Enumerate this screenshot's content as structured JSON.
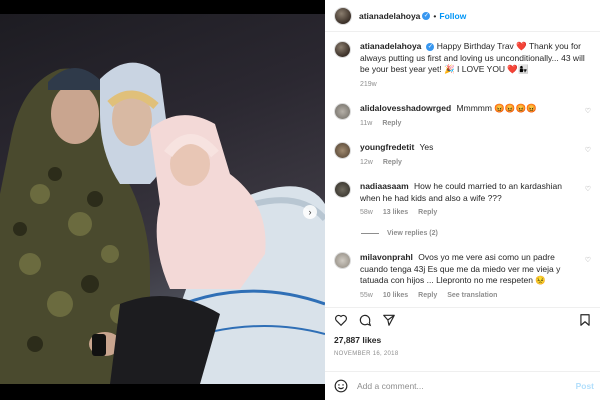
{
  "post": {
    "author": "atianadelahoya",
    "follow_label": "Follow",
    "separator": "•",
    "carousel_total": 3,
    "carousel_index": 1
  },
  "caption": {
    "username": "atianadelahoya",
    "text": "Happy Birthday Trav ❤️ Thank you for always putting us first and loving us unconditionally... 43 will be your best year yet! 🎉 I LOVE YOU ❤️👩‍👧",
    "time": "219w"
  },
  "comments": [
    {
      "username": "alidalovesshadowrged",
      "text": "Mmmmm 😡😡😡😡",
      "time": "11w",
      "likes": "",
      "reply": "Reply"
    },
    {
      "username": "youngfredetit",
      "text": "Yes",
      "time": "12w",
      "likes": "",
      "reply": "Reply"
    },
    {
      "username": "nadiaasaam",
      "text": "How he could married to an kardashian when he had kids and also a wife ???",
      "time": "58w",
      "likes": "13 likes",
      "reply": "Reply"
    },
    {
      "username": "milavonprahl",
      "text": "Ovos yo me vere asi como un padre cuando tenga 43j Es que me da miedo ver me vieja y tatuada con hijos ... Llepronto no me respeten 😣",
      "time": "55w",
      "likes": "10 likes",
      "reply": "Reply",
      "translation": "See translation"
    }
  ],
  "view_replies": "View replies (2)",
  "likes_count": "27,887 likes",
  "date": "NOVEMBER 16, 2018",
  "add_comment": {
    "placeholder": "Add a comment...",
    "post_label": "Post"
  },
  "icons": {
    "verified": "verified-badge-icon",
    "heart": "heart-icon",
    "comment": "comment-icon",
    "share": "share-icon",
    "save": "bookmark-icon",
    "emoji": "emoji-icon",
    "next": "chevron-right-icon"
  },
  "colors": {
    "accent": "#0095f6",
    "verified": "#3897f0",
    "muted": "#8e8e8e"
  }
}
